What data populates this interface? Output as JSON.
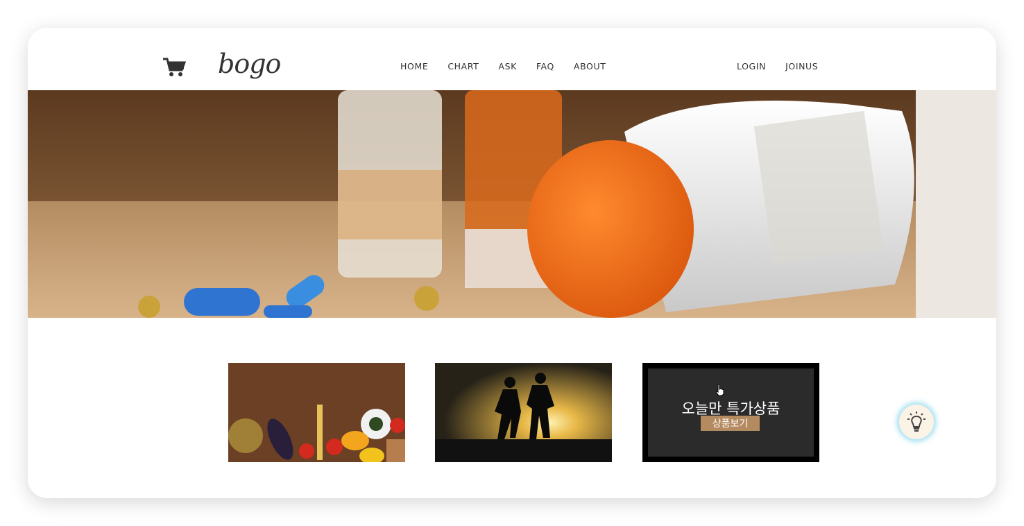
{
  "header": {
    "logo": "bogo",
    "nav": [
      "HOME",
      "CHART",
      "ASK",
      "FAQ",
      "ABOUT"
    ],
    "auth": [
      "LOGIN",
      "JOINUS"
    ]
  },
  "promo": {
    "title": "오늘만 특가상품",
    "button_label": "상품보기"
  },
  "icons": {
    "cart": "cart-icon",
    "bulb": "lightbulb-icon",
    "cursor": "hand-cursor-icon"
  },
  "colors": {
    "text": "#333333",
    "hero_cap": "#f07a20",
    "promo_bg": "#2b2b2b",
    "promo_button": "#b48a60",
    "bulb_glow": "#78d2eb"
  }
}
